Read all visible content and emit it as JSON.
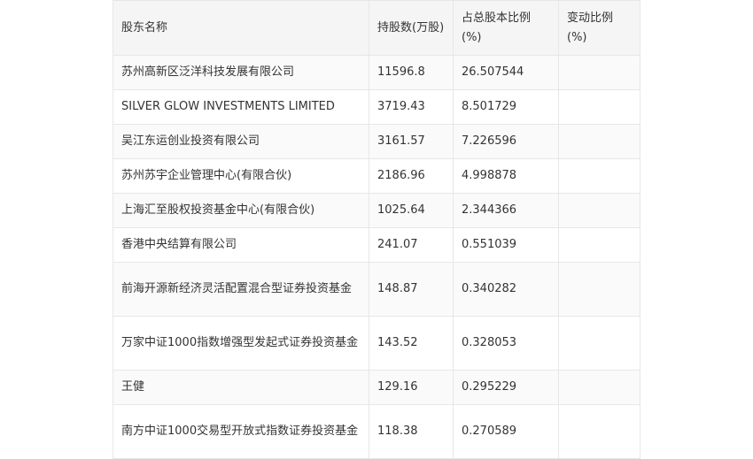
{
  "table": {
    "headers": [
      "股东名称",
      "持股数(万股)",
      "占总股本比例(%)",
      "变动比例(%)"
    ],
    "rows": [
      {
        "name": "苏州高新区泛洋科技发展有限公司",
        "shares": "11596.8",
        "ratio": "26.507544",
        "change": ""
      },
      {
        "name": "SILVER GLOW INVESTMENTS LIMITED",
        "shares": "3719.43",
        "ratio": "8.501729",
        "change": ""
      },
      {
        "name": "吴江东运创业投资有限公司",
        "shares": "3161.57",
        "ratio": "7.226596",
        "change": ""
      },
      {
        "name": "苏州苏宇企业管理中心(有限合伙)",
        "shares": "2186.96",
        "ratio": "4.998878",
        "change": ""
      },
      {
        "name": "上海汇至股权投资基金中心(有限合伙)",
        "shares": "1025.64",
        "ratio": "2.344366",
        "change": ""
      },
      {
        "name": "香港中央结算有限公司",
        "shares": "241.07",
        "ratio": "0.551039",
        "change": ""
      },
      {
        "name": "前海开源新经济灵活配置混合型证券投资基金",
        "shares": "148.87",
        "ratio": "0.340282",
        "change": ""
      },
      {
        "name": "万家中证1000指数增强型发起式证券投资基金",
        "shares": "143.52",
        "ratio": "0.328053",
        "change": ""
      },
      {
        "name": "王健",
        "shares": "129.16",
        "ratio": "0.295229",
        "change": ""
      },
      {
        "name": "南方中证1000交易型开放式指数证券投资基金",
        "shares": "118.38",
        "ratio": "0.270589",
        "change": ""
      }
    ]
  }
}
